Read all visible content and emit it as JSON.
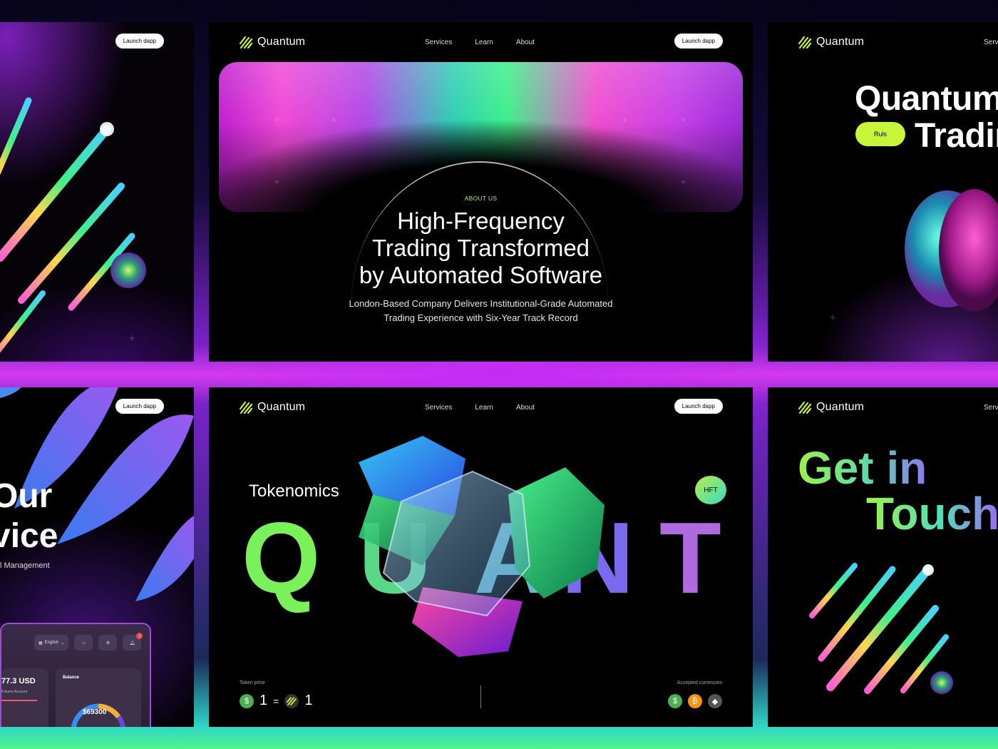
{
  "brand": {
    "name": "Quantum"
  },
  "nav": {
    "services": "Services",
    "learn": "Learn",
    "about": "About",
    "services_cut": "Serv"
  },
  "buttons": {
    "launch": "Launch dapp"
  },
  "about": {
    "eyebrow": "ABOUT US",
    "title_line1": "High-Frequency",
    "title_line2": "Trading Transformed",
    "title_line3": "by Automated Software",
    "subtitle_line1": "London-Based Company Delivers Institutional-Grade Automated",
    "subtitle_line2": "Trading Experience with Six-Year Track Record"
  },
  "trading": {
    "line1": "Quantum",
    "line2": "Tradir",
    "badge": "Ruls"
  },
  "service": {
    "title_line1": "Our",
    "title_line2": "vice",
    "subtitle": "l Management",
    "language": "English",
    "usd_value": "77.3 USD",
    "account_label": "Futures Account",
    "balance_label": "Balance",
    "balance_value": "$69300",
    "notification_count": "1"
  },
  "tokenomics": {
    "title": "Tokenomics",
    "word": [
      "Q",
      "U",
      "A",
      "N",
      "T"
    ],
    "badge": "HFT",
    "price_label": "Token price",
    "price_left": "1",
    "price_eq": "=",
    "price_right": "1",
    "accepted_label": "Accepted currencies",
    "currencies": [
      "$",
      "₿",
      "◆"
    ]
  },
  "touch": {
    "line1": "Get in",
    "line2": "Touch"
  },
  "colors": {
    "lime": "#b7f04a",
    "green": "#3ef08a",
    "magenta": "#d63af0",
    "purple": "#9a6af0",
    "usd_coin": "#4caf50",
    "btc_coin": "#f7931a",
    "eth_coin": "#555555"
  }
}
